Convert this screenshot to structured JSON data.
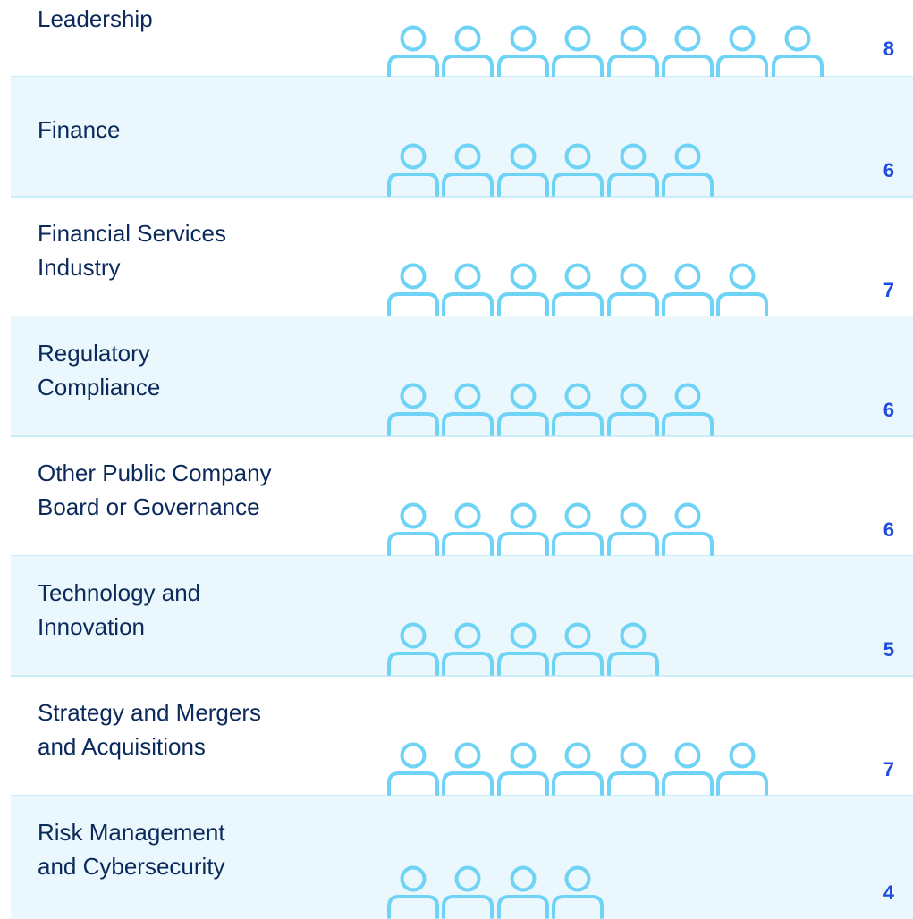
{
  "chart_data": {
    "type": "pictograph",
    "categories": [
      "Leadership",
      "Finance",
      "Financial Services\nIndustry",
      "Regulatory\nCompliance",
      "Other Public Company\nBoard or Governance",
      "Technology and\nInnovation",
      "Strategy and Mergers\nand Acquisitions",
      "Risk Management\nand Cybersecurity"
    ],
    "values": [
      8,
      6,
      7,
      6,
      6,
      5,
      7,
      4
    ],
    "value_labels": [
      "8",
      "6",
      "7",
      "6",
      "6",
      "5",
      "7",
      "4"
    ],
    "icon": "person-icon",
    "colors": {
      "icon": "#6fd3f5",
      "band": "#eaf7fc",
      "divider": "#c9edf9",
      "label": "#0b2a5b",
      "value": "#1d4de0"
    }
  }
}
